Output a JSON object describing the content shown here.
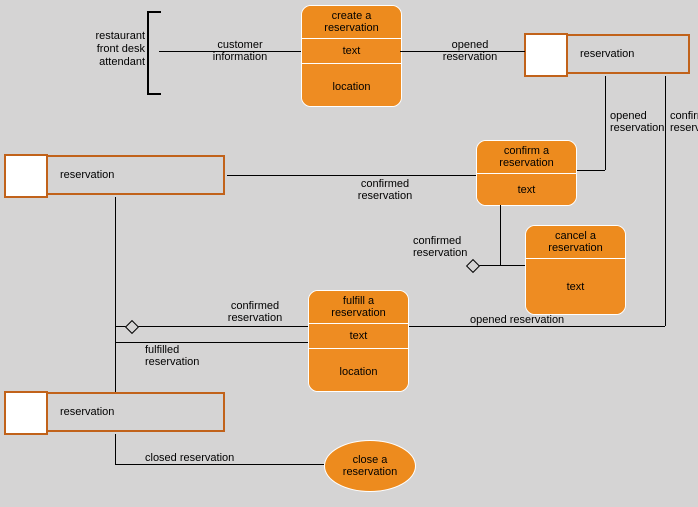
{
  "actor": {
    "label": "restaurant\nfront desk\nattendant"
  },
  "edges": {
    "customerInfo": "customer\ninformation",
    "openedReservation": "opened\nreservation",
    "openedReservationV": "opened\nreservation",
    "confirmedReservationV": "confirmed\nreservation",
    "confirmedReservation1": "confirmed\nreservation",
    "confirmedReservation2": "confirmed\nreservation",
    "confirmedReservation3": "confirmed\nreservation",
    "openedReservation2": "opened reservation",
    "fulfilledReservation": "fulfilled\nreservation",
    "closedReservation": "closed reservation"
  },
  "activities": {
    "create": {
      "title": "create a\nreservation",
      "sections": [
        "text",
        "location"
      ]
    },
    "confirm": {
      "title": "confirm a\nreservation",
      "sections": [
        "text"
      ]
    },
    "cancel": {
      "title": "cancel a\nreservation",
      "sections": [
        "text"
      ]
    },
    "fulfill": {
      "title": "fulfill a\nreservation",
      "sections": [
        "text",
        "location"
      ]
    },
    "close": {
      "title": "close a\nreservation"
    }
  },
  "artifacts": {
    "reservation1": "reservation",
    "reservation2": "reservation",
    "reservation3": "reservation"
  }
}
